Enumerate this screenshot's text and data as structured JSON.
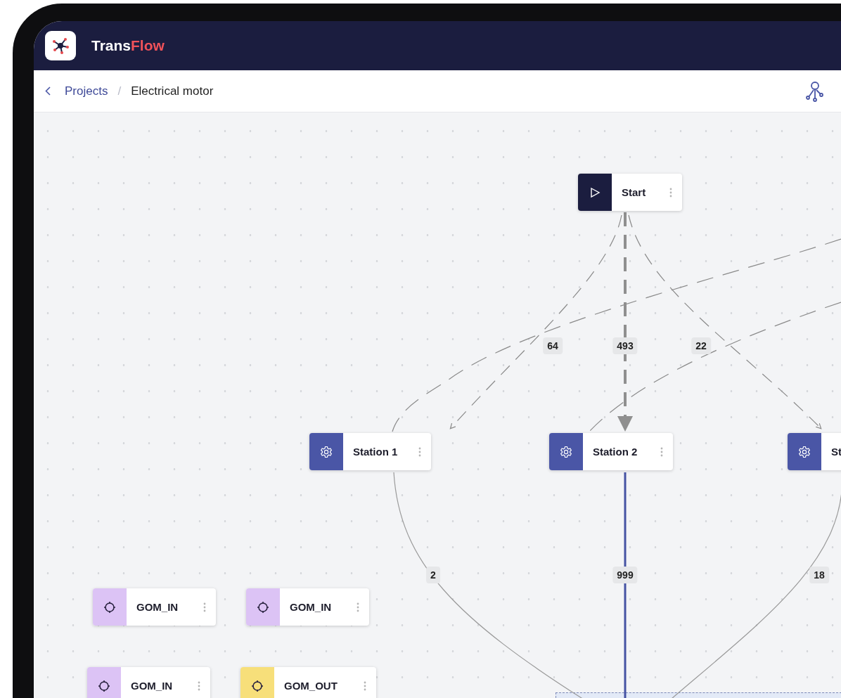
{
  "header": {
    "brand_prefix": "Trans",
    "brand_suffix": "Flow"
  },
  "breadcrumb": {
    "parent": "Projects",
    "separator": "/",
    "current": "Electrical motor"
  },
  "nodes": [
    {
      "kind": "start",
      "label": "Start"
    },
    {
      "kind": "station",
      "label": "Station 1"
    },
    {
      "kind": "station",
      "label": "Station 2"
    },
    {
      "kind": "station",
      "label": "St"
    },
    {
      "kind": "gom_in",
      "label": "GOM_IN"
    },
    {
      "kind": "gom_in",
      "label": "GOM_IN"
    },
    {
      "kind": "gom_in",
      "label": "GOM_IN"
    },
    {
      "kind": "gom_out",
      "label": "GOM_OUT"
    }
  ],
  "edges": [
    {
      "kind": "dashed",
      "label": "64"
    },
    {
      "kind": "bold-dashed",
      "label": "493"
    },
    {
      "kind": "dashed",
      "label": "22"
    },
    {
      "kind": "thin",
      "label": "2"
    },
    {
      "kind": "solid",
      "label": "999"
    },
    {
      "kind": "thin",
      "label": "18"
    }
  ]
}
